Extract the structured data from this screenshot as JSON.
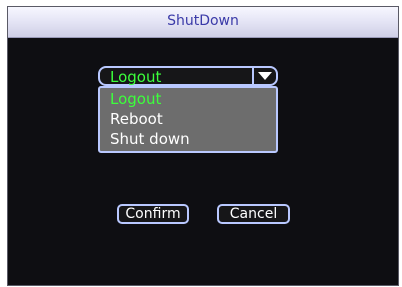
{
  "dialog": {
    "title": "ShutDown"
  },
  "dropdown": {
    "selected_value": "Logout",
    "arrow_icon": "chevron-down-icon",
    "options": [
      "Logout",
      "Reboot",
      "Shut down"
    ]
  },
  "buttons": {
    "confirm_label": "Confirm",
    "cancel_label": "Cancel"
  },
  "colors": {
    "selected_text": "#3cff3c",
    "border_accent": "#b9c8ff",
    "title_text": "#3a3aa8"
  }
}
